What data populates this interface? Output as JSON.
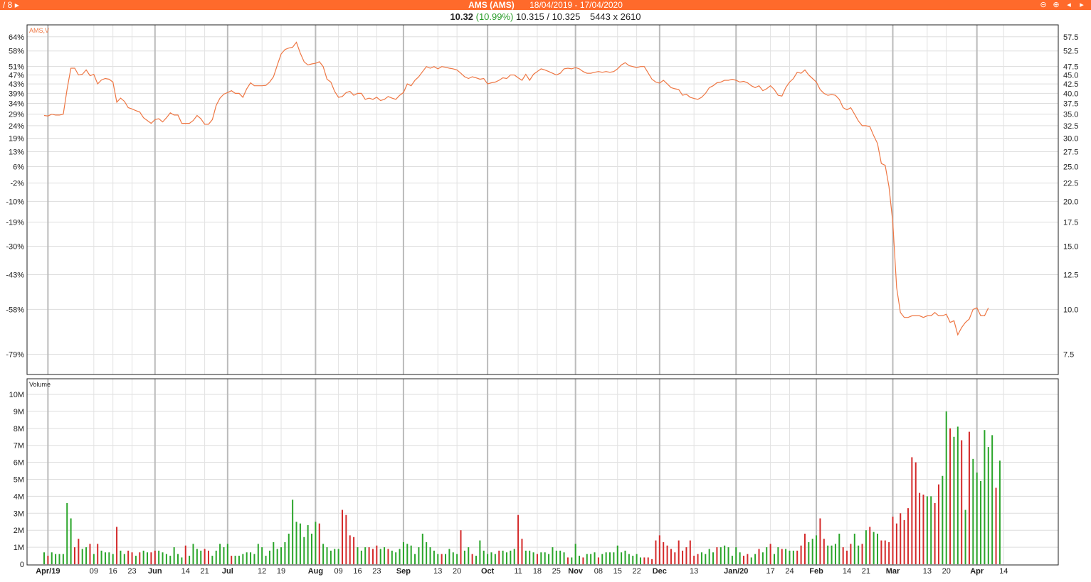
{
  "header": {
    "page_indicator": "/ 8",
    "play_icon": "play-right-icon",
    "symbol": "AMS (AMS)",
    "date_range": "18/04/2019 - 17/04/2020",
    "controls": [
      "zoom-out-icon",
      "zoom-in-icon",
      "prev-icon",
      "next-icon"
    ],
    "accent_color": "#ff6a2b"
  },
  "quote": {
    "last": "10.32",
    "change_pct": "(10.99%)",
    "bid_ask": "10.315 / 10.325",
    "size": "5443 x 2610"
  },
  "chart_data": {
    "type": "line",
    "price_panel": {
      "label": "AMS,V",
      "line_color": "#ee7744",
      "y_right_ticks": [
        "57.5",
        "52.5",
        "47.5",
        "45.0",
        "42.5",
        "40.0",
        "37.5",
        "35.0",
        "32.5",
        "30.0",
        "27.5",
        "25.0",
        "22.5",
        "20.0",
        "17.5",
        "15.0",
        "12.5",
        "10.0",
        "7.5"
      ],
      "y_left_ticks": [
        "64%",
        "58%",
        "51%",
        "47%",
        "43%",
        "39%",
        "34%",
        "29%",
        "24%",
        "19%",
        "13%",
        "6%",
        "-2%",
        "-10%",
        "-19%",
        "-30%",
        "-43%",
        "-58%",
        "-79%"
      ],
      "ylim": [
        6.8,
        58.5
      ],
      "scale": "log",
      "x_range": [
        0,
        262
      ],
      "x": [
        0,
        1,
        2,
        3,
        4,
        5,
        6,
        7,
        8,
        9,
        10,
        11,
        12,
        13,
        14,
        15,
        16,
        17,
        18,
        19,
        20,
        21,
        22,
        23,
        24,
        25,
        26,
        27,
        28,
        29,
        30,
        31,
        32,
        33,
        34,
        35,
        36,
        37,
        38,
        39,
        40,
        41,
        42,
        43,
        44,
        45,
        46,
        47,
        48,
        49,
        50,
        51,
        52,
        53,
        54,
        55,
        56,
        57,
        58,
        59,
        60,
        61,
        62,
        63,
        64,
        65,
        66,
        67,
        68,
        69,
        70,
        71,
        72,
        73,
        74,
        75,
        76,
        77,
        78,
        79,
        80,
        81,
        82,
        83,
        84,
        85,
        86,
        87,
        88,
        89,
        90,
        91,
        92,
        93,
        94,
        95,
        96,
        97,
        98,
        99,
        100,
        101,
        102,
        103,
        104,
        105,
        106,
        107,
        108,
        109,
        110,
        111,
        112,
        113,
        114,
        115,
        116,
        117,
        118,
        119,
        120,
        121,
        122,
        123,
        124,
        125,
        126,
        127,
        128,
        129,
        130,
        131,
        132,
        133,
        134,
        135,
        136,
        137,
        138,
        139,
        140,
        141,
        142,
        143,
        144,
        145,
        146,
        147,
        148,
        149,
        150,
        151,
        152,
        153,
        154,
        155,
        156,
        157,
        158,
        159,
        160,
        161,
        162,
        163,
        164,
        165,
        166,
        167,
        168,
        169,
        170,
        171,
        172,
        173,
        174,
        175,
        176,
        177,
        178,
        179,
        180,
        181,
        182,
        183,
        184,
        185,
        186,
        187,
        188,
        189,
        190,
        191,
        192,
        193,
        194,
        195,
        196,
        197,
        198,
        199,
        200,
        201,
        202,
        203,
        204,
        205,
        206,
        207,
        208,
        209,
        210,
        211,
        212,
        213,
        214,
        215,
        216,
        217,
        218,
        219,
        220,
        221,
        222,
        223,
        224,
        225,
        226,
        227,
        228,
        229,
        230,
        231,
        232,
        233,
        234,
        235,
        236,
        237,
        238,
        239,
        240,
        241,
        242,
        243,
        244,
        245,
        246,
        247,
        248,
        249,
        250,
        251,
        252,
        253,
        254,
        255,
        256,
        257,
        258,
        259,
        260,
        261
      ],
      "values": [
        34.7,
        34.6,
        35.0,
        34.8,
        34.8,
        35.0,
        41.0,
        47.0,
        47.0,
        45.0,
        45.2,
        46.5,
        44.8,
        45.2,
        42.5,
        43.6,
        44.0,
        43.8,
        43.0,
        37.8,
        38.8,
        38.0,
        36.5,
        36.2,
        35.8,
        35.5,
        34.2,
        33.6,
        33.0,
        33.8,
        34.0,
        33.3,
        34.2,
        35.3,
        34.8,
        34.8,
        33.0,
        33.0,
        33.0,
        33.6,
        34.7,
        34.0,
        32.8,
        32.8,
        33.8,
        37.0,
        38.8,
        39.8,
        40.2,
        40.7,
        40.0,
        40.0,
        39.0,
        41.2,
        42.8,
        42.0,
        42.0,
        42.0,
        42.1,
        43.0,
        44.5,
        48.0,
        51.5,
        53.0,
        53.5,
        53.8,
        55.5,
        51.8,
        49.0,
        48.0,
        48.3,
        48.5,
        49.0,
        47.5,
        43.8,
        43.0,
        40.5,
        39.0,
        39.2,
        40.2,
        40.5,
        39.5,
        40.0,
        40.0,
        38.5,
        38.8,
        38.5,
        39.0,
        38.2,
        38.5,
        39.2,
        38.8,
        38.5,
        39.5,
        40.2,
        42.5,
        42.0,
        43.5,
        44.5,
        46.0,
        47.5,
        47.0,
        47.5,
        46.8,
        47.5,
        47.3,
        47.0,
        46.8,
        46.5,
        45.5,
        44.5,
        44.0,
        44.5,
        44.2,
        43.8,
        44.0,
        42.5,
        42.8,
        43.0,
        43.5,
        44.2,
        44.0,
        45.0,
        45.0,
        44.2,
        43.5,
        45.2,
        43.5,
        45.2,
        46.0,
        46.8,
        46.5,
        46.0,
        45.5,
        45.0,
        45.5,
        46.8,
        47.0,
        46.8,
        47.2,
        46.8,
        46.0,
        45.5,
        45.5,
        45.8,
        46.0,
        45.8,
        46.0,
        45.8,
        46.0,
        46.8,
        48.0,
        48.7,
        47.8,
        47.5,
        47.2,
        47.5,
        47.5,
        45.6,
        43.8,
        43.0,
        42.7,
        43.5,
        42.5,
        41.5,
        41.2,
        41.0,
        39.5,
        39.8,
        39.0,
        38.7,
        38.5,
        39.0,
        40.0,
        41.5,
        42.0,
        42.8,
        43.0,
        43.5,
        43.5,
        43.8,
        43.5,
        43.0,
        43.2,
        42.8,
        42.0,
        41.5,
        42.0,
        40.7,
        41.2,
        42.0,
        41.0,
        39.5,
        39.3,
        41.5,
        43.0,
        44.0,
        45.8,
        45.5,
        46.5,
        45.0,
        44.0,
        43.0,
        41.0,
        40.0,
        39.5,
        39.7,
        39.5,
        38.5,
        36.5,
        36.0,
        36.5,
        35.0,
        33.5,
        32.5,
        32.5,
        32.3,
        30.5,
        29.0,
        25.5,
        25.2,
        22.0,
        17.5,
        11.5,
        9.8,
        9.5,
        9.5,
        9.6,
        9.6,
        9.6,
        9.5,
        9.6,
        9.6,
        9.8,
        9.6,
        9.6,
        9.7,
        9.2,
        9.3,
        8.5,
        8.9,
        9.2,
        9.4,
        10.0,
        10.1,
        9.6,
        9.6,
        10.1
      ]
    },
    "volume_panel": {
      "label": "Volume",
      "ylim": [
        0,
        10500000
      ],
      "y_ticks": [
        "0",
        "1M",
        "2M",
        "3M",
        "4M",
        "5M",
        "6M",
        "7M",
        "8M",
        "9M",
        "10M"
      ],
      "colors": {
        "up": "#2aa52a",
        "down": "#d42a2a"
      },
      "values": [
        0.7,
        0.5,
        0.7,
        0.6,
        0.6,
        0.6,
        3.6,
        2.7,
        1.0,
        1.5,
        0.9,
        1.0,
        1.2,
        0.6,
        1.2,
        0.8,
        0.7,
        0.7,
        0.6,
        2.2,
        0.8,
        0.6,
        0.8,
        0.7,
        0.5,
        0.7,
        0.8,
        0.7,
        0.7,
        0.8,
        0.8,
        0.7,
        0.6,
        0.5,
        1.0,
        0.6,
        0.4,
        1.1,
        0.5,
        1.2,
        0.9,
        0.8,
        0.9,
        0.8,
        0.5,
        0.8,
        1.2,
        1.0,
        1.2,
        0.5,
        0.5,
        0.5,
        0.6,
        0.7,
        0.7,
        0.6,
        1.2,
        1.0,
        0.5,
        0.8,
        1.3,
        0.9,
        1.0,
        1.3,
        1.8,
        3.8,
        2.5,
        2.4,
        1.6,
        2.3,
        1.8,
        2.5,
        2.4,
        1.2,
        1.0,
        0.8,
        0.9,
        0.9,
        3.2,
        2.9,
        1.7,
        1.6,
        1.0,
        0.8,
        1.0,
        1.0,
        0.9,
        1.1,
        0.9,
        1.0,
        0.9,
        0.8,
        0.7,
        0.9,
        1.3,
        1.2,
        1.1,
        0.6,
        1.0,
        1.8,
        1.3,
        1.0,
        0.8,
        0.6,
        0.6,
        0.6,
        0.9,
        0.7,
        0.6,
        2.0,
        0.8,
        1.0,
        0.6,
        0.5,
        1.4,
        0.8,
        0.6,
        0.7,
        0.6,
        0.8,
        0.8,
        0.7,
        0.8,
        0.9,
        2.9,
        1.5,
        0.8,
        0.8,
        0.7,
        0.6,
        0.7,
        0.7,
        0.6,
        1.0,
        0.8,
        0.8,
        0.7,
        0.4,
        0.4,
        1.2,
        0.5,
        0.4,
        0.6,
        0.6,
        0.7,
        0.4,
        0.6,
        0.7,
        0.7,
        0.7,
        1.1,
        0.7,
        0.8,
        0.6,
        0.5,
        0.6,
        0.4,
        0.4,
        0.4,
        0.3,
        1.4,
        1.7,
        1.3,
        1.1,
        0.9,
        0.7,
        1.4,
        0.8,
        1.0,
        1.4,
        0.5,
        0.6,
        0.7,
        0.6,
        0.9,
        0.7,
        1.0,
        1.0,
        1.1,
        1.0,
        0.5,
        1.0,
        0.7,
        0.5,
        0.6,
        0.4,
        0.6,
        0.9,
        0.7,
        1.0,
        1.2,
        0.6,
        1.0,
        0.9,
        0.9,
        0.8,
        0.8,
        0.8,
        1.1,
        1.8,
        1.3,
        1.5,
        1.7,
        2.7,
        1.5,
        1.1,
        1.1,
        1.2,
        1.8,
        1.0,
        0.8,
        1.2,
        1.8,
        1.1,
        1.2,
        2.0,
        2.2,
        1.9,
        1.8,
        1.4,
        1.4,
        1.3,
        2.8,
        2.4,
        3.0,
        2.6,
        3.3,
        6.3,
        6.0,
        4.2,
        4.1,
        4.0,
        4.0,
        3.6,
        4.7,
        5.2,
        9.0,
        8.0,
        7.5,
        8.1,
        7.3,
        3.2,
        7.8,
        6.2,
        5.4,
        4.9,
        7.9,
        6.9,
        7.6,
        4.5,
        6.1
      ],
      "up_flags": [
        1,
        0,
        1,
        1,
        1,
        1,
        1,
        1,
        0,
        0,
        1,
        1,
        0,
        1,
        0,
        1,
        1,
        1,
        1,
        0,
        1,
        1,
        0,
        0,
        1,
        0,
        1,
        1,
        0,
        0,
        1,
        1,
        1,
        1,
        1,
        1,
        1,
        0,
        1,
        1,
        1,
        1,
        0,
        0,
        1,
        1,
        1,
        1,
        1,
        0,
        1,
        1,
        1,
        1,
        1,
        1,
        1,
        1,
        1,
        1,
        1,
        1,
        1,
        1,
        1,
        1,
        1,
        1,
        1,
        1,
        1,
        1,
        0,
        1,
        1,
        1,
        1,
        1,
        0,
        0,
        0,
        0,
        1,
        1,
        1,
        0,
        0,
        0,
        1,
        1,
        0,
        1,
        1,
        1,
        1,
        1,
        1,
        1,
        1,
        1,
        1,
        1,
        1,
        1,
        0,
        1,
        1,
        1,
        1,
        0,
        1,
        1,
        0,
        1,
        1,
        1,
        1,
        1,
        1,
        0,
        1,
        1,
        1,
        1,
        0,
        0,
        1,
        1,
        1,
        0,
        1,
        1,
        1,
        1,
        1,
        1,
        1,
        0,
        1,
        1,
        1,
        0,
        1,
        1,
        1,
        0,
        1,
        1,
        1,
        1,
        1,
        1,
        1,
        1,
        1,
        1,
        1,
        0,
        0,
        0,
        0,
        0,
        0,
        0,
        0,
        0,
        0,
        0,
        0,
        0,
        0,
        0,
        1,
        1,
        1,
        1,
        0,
        1,
        1,
        1,
        1,
        1,
        1,
        0,
        0,
        1,
        1,
        0,
        1,
        1,
        0,
        1,
        1,
        0,
        1,
        1,
        1,
        0,
        0,
        0,
        1,
        1,
        1,
        0,
        0,
        1,
        1,
        1,
        1,
        0,
        0,
        0,
        1,
        1,
        0,
        1,
        0,
        1,
        1,
        0,
        0,
        0,
        0,
        0,
        0,
        0,
        0,
        0,
        0,
        0,
        0,
        1,
        1,
        0,
        0,
        1,
        1,
        0,
        1,
        1,
        0,
        1,
        0,
        1,
        1,
        1,
        1,
        1,
        1,
        0,
        1
      ],
      "unit_multiplier": 1000000
    },
    "x_axis": {
      "ticks": [
        {
          "x": 1,
          "label": "Apr/19",
          "bold": true
        },
        {
          "x": 13,
          "label": "09"
        },
        {
          "x": 18,
          "label": "16"
        },
        {
          "x": 23,
          "label": "23"
        },
        {
          "x": 29,
          "label": "Jun",
          "bold": true
        },
        {
          "x": 37,
          "label": "14"
        },
        {
          "x": 42,
          "label": "21"
        },
        {
          "x": 48,
          "label": "Jul",
          "bold": true
        },
        {
          "x": 57,
          "label": "12"
        },
        {
          "x": 62,
          "label": "19"
        },
        {
          "x": 71,
          "label": "Aug",
          "bold": true
        },
        {
          "x": 77,
          "label": "09"
        },
        {
          "x": 82,
          "label": "16"
        },
        {
          "x": 87,
          "label": "23"
        },
        {
          "x": 94,
          "label": "Sep",
          "bold": true
        },
        {
          "x": 103,
          "label": "13"
        },
        {
          "x": 108,
          "label": "20"
        },
        {
          "x": 116,
          "label": "Oct",
          "bold": true
        },
        {
          "x": 124,
          "label": "11"
        },
        {
          "x": 129,
          "label": "18"
        },
        {
          "x": 134,
          "label": "25"
        },
        {
          "x": 139,
          "label": "Nov",
          "bold": true
        },
        {
          "x": 145,
          "label": "08"
        },
        {
          "x": 150,
          "label": "15"
        },
        {
          "x": 155,
          "label": "22"
        },
        {
          "x": 161,
          "label": "Dec",
          "bold": true
        },
        {
          "x": 170,
          "label": "13"
        },
        {
          "x": 181,
          "label": "Jan/20",
          "bold": true
        },
        {
          "x": 190,
          "label": "17"
        },
        {
          "x": 195,
          "label": "24"
        },
        {
          "x": 202,
          "label": "Feb",
          "bold": true
        },
        {
          "x": 210,
          "label": "14"
        },
        {
          "x": 215,
          "label": "21"
        },
        {
          "x": 222,
          "label": "Mar",
          "bold": true
        },
        {
          "x": 231,
          "label": "13"
        },
        {
          "x": 236,
          "label": "20"
        },
        {
          "x": 244,
          "label": "Apr",
          "bold": true
        },
        {
          "x": 251,
          "label": "14"
        }
      ]
    }
  }
}
